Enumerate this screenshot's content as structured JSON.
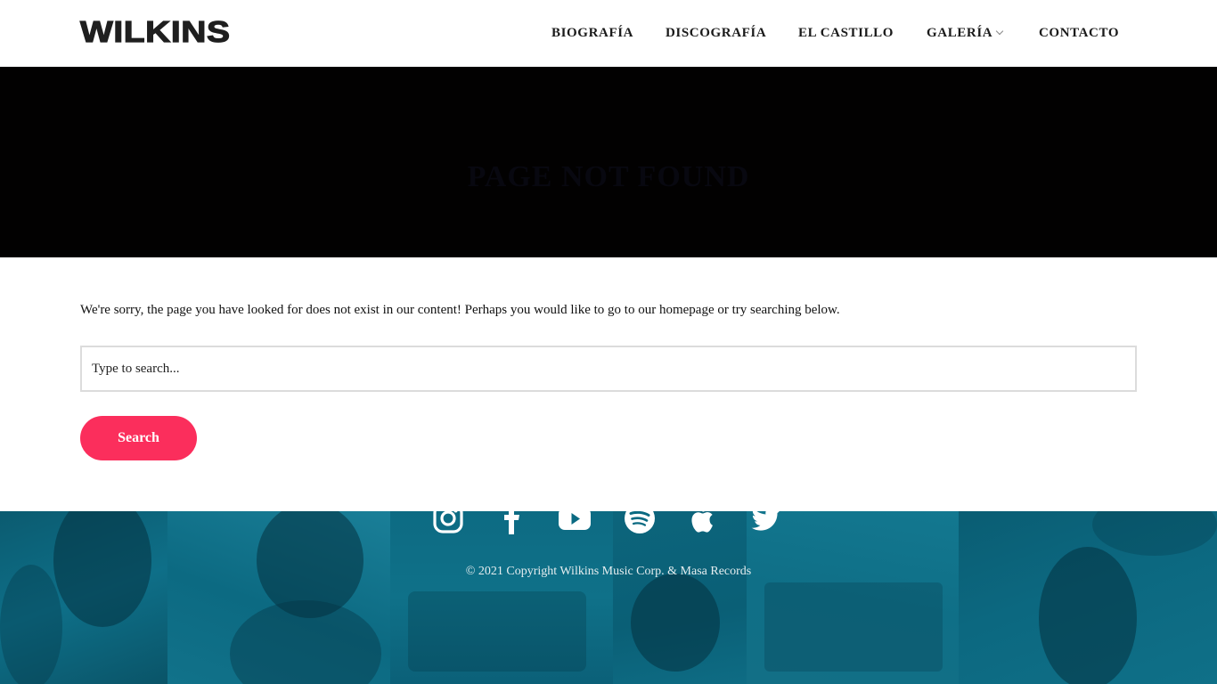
{
  "header": {
    "logo": "WILKINS",
    "nav": [
      {
        "label": "BIOGRAFÍA"
      },
      {
        "label": "DISCOGRAFÍA"
      },
      {
        "label": "EL CASTILLO"
      },
      {
        "label": "GALERÍA"
      },
      {
        "label": "CONTACTO"
      }
    ]
  },
  "banner": {
    "title": "PAGE NOT FOUND"
  },
  "main": {
    "message": "We're sorry, the page you have looked for does not exist in our content! Perhaps you would like to go to our homepage or try searching below.",
    "search_placeholder": "Type to search...",
    "search_button": "Search"
  },
  "footer": {
    "social_icons": [
      "instagram-icon",
      "facebook-icon",
      "youtube-icon",
      "spotify-icon",
      "apple-icon",
      "twitter-icon"
    ],
    "copyright": "© 2021 Copyright Wilkins Music Corp. & Masa Records"
  },
  "colors": {
    "accent": "#fb2e5c",
    "footer_bg": "#0a6a82",
    "banner_bg": "#020101"
  }
}
